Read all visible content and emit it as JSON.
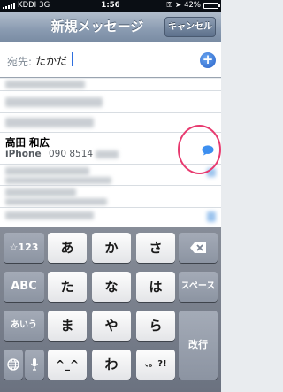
{
  "status": {
    "carrier": "KDDI",
    "network": "3G",
    "time": "1:56",
    "battery": "42%",
    "battery_level": 0.42
  },
  "nav": {
    "title": "新規メッセージ",
    "cancel_label": "キャンセル"
  },
  "to_field": {
    "label": "宛先:",
    "value": "たかだ"
  },
  "contact": {
    "name": "高田 和広",
    "type": "iPhone",
    "number": "090 8514"
  },
  "keyboard": {
    "row1": [
      "☆123",
      "あ",
      "か",
      "さ"
    ],
    "row2": [
      "ABC",
      "た",
      "な",
      "は",
      "スペース"
    ],
    "row3": [
      "あいう",
      "ま",
      "や",
      "ら",
      "改行"
    ],
    "row4": [
      "^_^",
      "わ",
      "、。?!"
    ]
  },
  "colors": {
    "highlight": "#e83a6f",
    "accent": "#2f6fde"
  }
}
